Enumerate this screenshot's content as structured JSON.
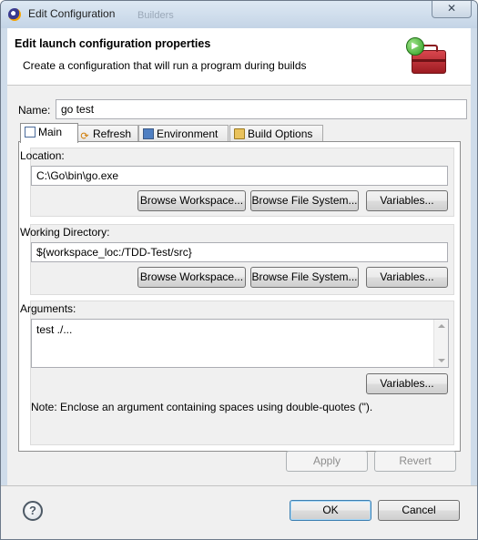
{
  "window": {
    "title": "Edit Configuration",
    "title_ghost": "Builders",
    "close_label": "✕"
  },
  "header": {
    "title": "Edit launch configuration properties",
    "description": "Create a configuration that will run a program during builds"
  },
  "name": {
    "label": "Name:",
    "value": "go test"
  },
  "tabs": [
    {
      "label": "Main",
      "icon": "main-tab-icon",
      "active": true
    },
    {
      "label": "Refresh",
      "icon": "refresh-icon"
    },
    {
      "label": "Environment",
      "icon": "environment-icon"
    },
    {
      "label": "Build Options",
      "icon": "build-options-icon"
    }
  ],
  "location": {
    "label": "Location:",
    "value": "C:\\Go\\bin\\go.exe",
    "buttons": {
      "browse_workspace": "Browse Workspace...",
      "browse_filesystem": "Browse File System...",
      "variables": "Variables..."
    }
  },
  "working_directory": {
    "label": "Working Directory:",
    "value": "${workspace_loc:/TDD-Test/src}",
    "buttons": {
      "browse_workspace": "Browse Workspace...",
      "browse_filesystem": "Browse File System...",
      "variables": "Variables..."
    }
  },
  "arguments": {
    "label": "Arguments:",
    "value": "test ./...",
    "variables": "Variables...",
    "note": "Note: Enclose an argument containing spaces using double-quotes (\")."
  },
  "actions": {
    "apply": "Apply",
    "revert": "Revert",
    "ok": "OK",
    "cancel": "Cancel",
    "help": "?"
  },
  "colors": {
    "accent": "#3c7fb1",
    "titlebar": "#c4d4e6"
  }
}
